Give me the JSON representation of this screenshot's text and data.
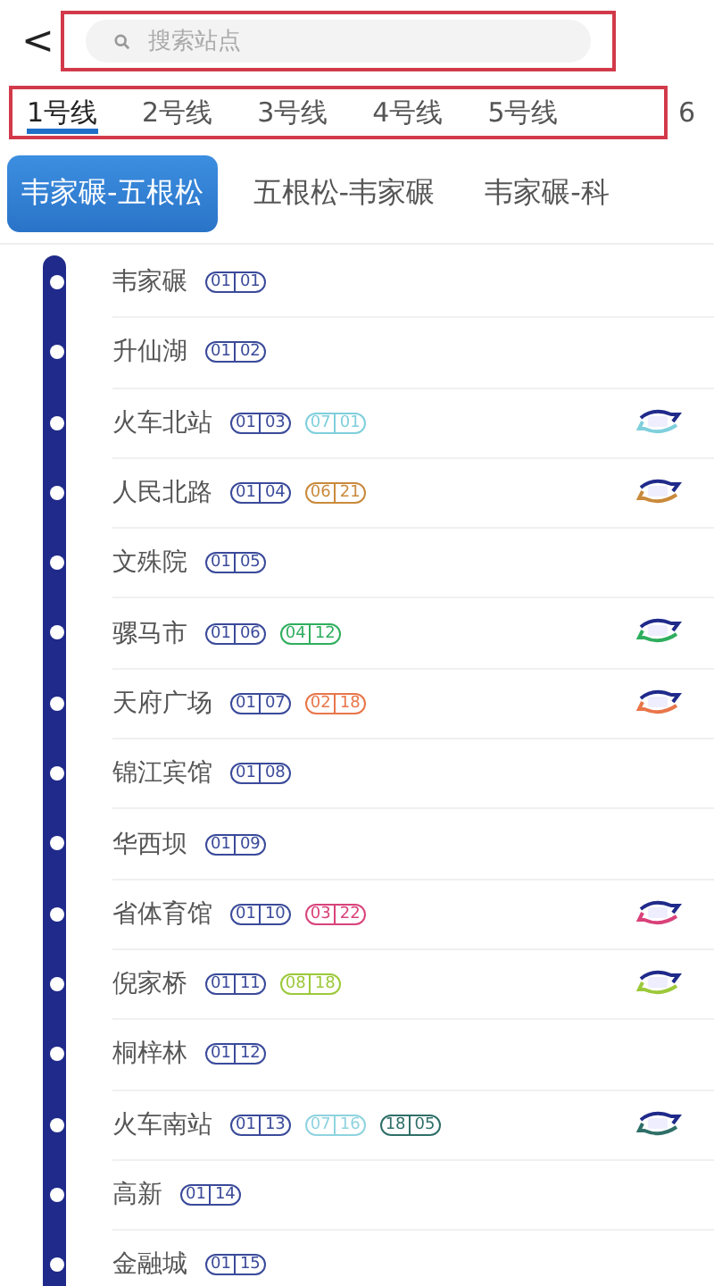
{
  "header": {
    "back": "<",
    "search": {
      "placeholder": "搜索站点"
    }
  },
  "line_tabs": [
    {
      "label": "1号线",
      "selected": true
    },
    {
      "label": "2号线",
      "selected": false
    },
    {
      "label": "3号线",
      "selected": false
    },
    {
      "label": "4号线",
      "selected": false
    },
    {
      "label": "5号线",
      "selected": false
    },
    {
      "label": "6",
      "selected": false
    }
  ],
  "direction_tabs": [
    {
      "label": "韦家碾-五根松",
      "selected": true
    },
    {
      "label": "五根松-韦家碾",
      "selected": false
    },
    {
      "label": "韦家碾-科",
      "selected": false
    }
  ],
  "stations": [
    {
      "name": "韦家碾",
      "codes": [
        {
          "line": "01",
          "stop": "01",
          "color": "#3a4a9a"
        }
      ],
      "transfer": false
    },
    {
      "name": "升仙湖",
      "codes": [
        {
          "line": "01",
          "stop": "02",
          "color": "#3a4a9a"
        }
      ],
      "transfer": false
    },
    {
      "name": "火车北站",
      "codes": [
        {
          "line": "01",
          "stop": "03",
          "color": "#3a4a9a"
        },
        {
          "line": "07",
          "stop": "01",
          "color": "#7fcfdc"
        }
      ],
      "transfer": true
    },
    {
      "name": "人民北路",
      "codes": [
        {
          "line": "01",
          "stop": "04",
          "color": "#3a4a9a"
        },
        {
          "line": "06",
          "stop": "21",
          "color": "#c98a3c"
        }
      ],
      "transfer": true
    },
    {
      "name": "文殊院",
      "codes": [
        {
          "line": "01",
          "stop": "05",
          "color": "#3a4a9a"
        }
      ],
      "transfer": false
    },
    {
      "name": "骡马市",
      "codes": [
        {
          "line": "01",
          "stop": "06",
          "color": "#3a4a9a"
        },
        {
          "line": "04",
          "stop": "12",
          "color": "#2fae5e"
        }
      ],
      "transfer": true
    },
    {
      "name": "天府广场",
      "codes": [
        {
          "line": "01",
          "stop": "07",
          "color": "#3a4a9a"
        },
        {
          "line": "02",
          "stop": "18",
          "color": "#e8764a"
        }
      ],
      "transfer": true
    },
    {
      "name": "锦江宾馆",
      "codes": [
        {
          "line": "01",
          "stop": "08",
          "color": "#3a4a9a"
        }
      ],
      "transfer": false
    },
    {
      "name": "华西坝",
      "codes": [
        {
          "line": "01",
          "stop": "09",
          "color": "#3a4a9a"
        }
      ],
      "transfer": false
    },
    {
      "name": "省体育馆",
      "codes": [
        {
          "line": "01",
          "stop": "10",
          "color": "#3a4a9a"
        },
        {
          "line": "03",
          "stop": "22",
          "color": "#d9427a"
        }
      ],
      "transfer": true
    },
    {
      "name": "倪家桥",
      "codes": [
        {
          "line": "01",
          "stop": "11",
          "color": "#3a4a9a"
        },
        {
          "line": "08",
          "stop": "18",
          "color": "#9cc93a"
        }
      ],
      "transfer": true
    },
    {
      "name": "桐梓林",
      "codes": [
        {
          "line": "01",
          "stop": "12",
          "color": "#3a4a9a"
        }
      ],
      "transfer": false
    },
    {
      "name": "火车南站",
      "codes": [
        {
          "line": "01",
          "stop": "13",
          "color": "#3a4a9a"
        },
        {
          "line": "07",
          "stop": "16",
          "color": "#8fd3e0"
        },
        {
          "line": "18",
          "stop": "05",
          "color": "#2f6f68"
        }
      ],
      "transfer": true
    },
    {
      "name": "高新",
      "codes": [
        {
          "line": "01",
          "stop": "14",
          "color": "#3a4a9a"
        }
      ],
      "transfer": false
    },
    {
      "name": "金融城",
      "codes": [
        {
          "line": "01",
          "stop": "15",
          "color": "#3a4a9a"
        }
      ],
      "transfer": false
    }
  ]
}
